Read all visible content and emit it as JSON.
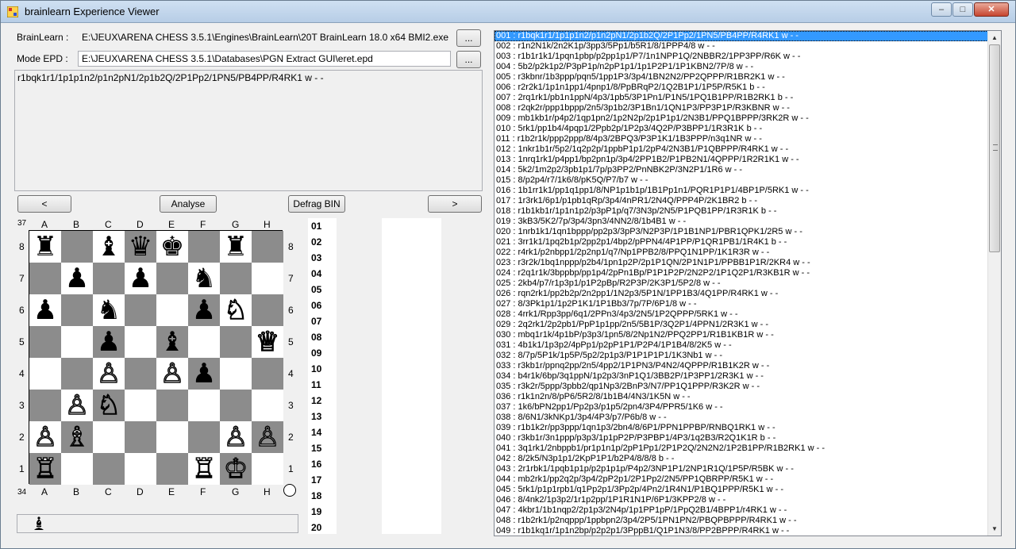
{
  "window": {
    "title": "brainlearn Experience Viewer",
    "minimize": "–",
    "maximize": "□",
    "close": "✕"
  },
  "engine": {
    "label": "BrainLearn :",
    "path": "E:\\JEUX\\ARENA CHESS 3.5.1\\Engines\\BrainLearn\\20T BrainLearn 18.0 x64 BMI2.exe",
    "browse": "..."
  },
  "epd": {
    "label": "Mode EPD :",
    "path": "E:\\JEUX\\ARENA CHESS 3.5.1\\Databases\\PGN Extract GUI\\eret.epd",
    "browse": "..."
  },
  "fen": "r1bqk1r1/1p1p1n2/p1n2pN1/2p1b2Q/2P1Pp2/1PN5/PB4PP/R4RK1 w - -",
  "buttons": {
    "prev": "<",
    "analyse": "Analyse",
    "defrag": "Defrag BIN",
    "next": ">"
  },
  "board": {
    "move_top": "37",
    "move_bottom": "34",
    "files": [
      "A",
      "B",
      "C",
      "D",
      "E",
      "F",
      "G",
      "H"
    ],
    "ranks": [
      "8",
      "7",
      "6",
      "5",
      "4",
      "3",
      "2",
      "1"
    ],
    "pieces": [
      [
        "r",
        "",
        "b",
        "q",
        "k",
        "",
        "r",
        ""
      ],
      [
        "",
        "p",
        "",
        "p",
        "",
        "n",
        "",
        ""
      ],
      [
        "p",
        "",
        "n",
        "",
        "",
        "p",
        "N",
        ""
      ],
      [
        "",
        "",
        "p",
        "",
        "b",
        "",
        "",
        "Q"
      ],
      [
        "",
        "",
        "P",
        "",
        "P",
        "p",
        "",
        ""
      ],
      [
        "",
        "P",
        "N",
        "",
        "",
        "",
        "",
        ""
      ],
      [
        "P",
        "B",
        "",
        "",
        "",
        "",
        "P",
        "P"
      ],
      [
        "R",
        "",
        "",
        "",
        "",
        "R",
        "K",
        ""
      ]
    ]
  },
  "move_numbers": [
    "01",
    "02",
    "03",
    "04",
    "05",
    "06",
    "07",
    "08",
    "09",
    "10",
    "11",
    "12",
    "13",
    "14",
    "15",
    "16",
    "17",
    "18",
    "19",
    "20"
  ],
  "status_icon": "black-bishop-icon",
  "positions": [
    "001 : r1bqk1r1/1p1p1n2/p1n2pN1/2p1b2Q/2P1Pp2/1PN5/PB4PP/R4RK1 w - -",
    "002 : r1n2N1k/2n2K1p/3pp3/5Pp1/b5R1/8/1PPP4/8 w - -",
    "003 : r1b1r1k1/1pqn1pbp/p2pp1p1/P7/1n1NPP1Q/2NBBR2/1PP3PP/R6K w - -",
    "004 : 5b2/p2k1p2/P3pP1p/n2pP1p1/1p1P2P1/1P1KBN2/7P/8 w - -",
    "005 : r3kbnr/1b3ppp/pqn5/1pp1P3/3p4/1BN2N2/PP2QPPP/R1BR2K1 w - -",
    "006 : r2r2k1/1p1n1pp1/4pnp1/8/PpBRqP2/1Q2B1P1/1P5P/R5K1 b - -",
    "007 : 2rq1rk1/pb1n1ppN/4p3/1pb5/3P1Pn1/P1N5/1PQ1B1PP/R1B2RK1 b - -",
    "008 : r2qk2r/ppp1bppp/2n5/3p1b2/3P1Bn1/1QN1P3/PP3P1P/R3KBNR w - -",
    "009 : mb1kb1r/p4p2/1qp1pn2/1p2N2p/2p1P1p1/2N3B1/PPQ1BPPP/3RK2R w - -",
    "010 : 5rk1/pp1b4/4pqp1/2Ppb2p/1P2p3/4Q2P/P3BPP1/1R3R1K b - -",
    "011 : r1b2r1k/ppp2ppp/8/4p3/2BPQ3/P3P1K1/1B3PPP/n3q1NR w - -",
    "012 : 1nkr1b1r/5p2/1q2p2p/1ppbP1p1/2pP4/2N3B1/P1QBPPP/R4RK1 w - -",
    "013 : 1nrq1rk1/p4pp1/bp2pn1p/3p4/2PP1B2/P1PB2N1/4QPPP/1R2R1K1 w - -",
    "014 : 5k2/1m2p2/3pb1p1/7p/p3PP2/PnNBK2P/3N2P1/1R6 w - -",
    "015 : 8/p2p4/r7/1k6/8/pK5Q/P7/b7 w - -",
    "016 : 1b1rr1k1/pp1q1pp1/8/NP1p1b1p/1B1Pp1n1/PQR1P1P1/4BP1P/5RK1 w - -",
    "017 : 1r3rk1/6p1/p1pb1qRp/3p4/4nPR1/2N4Q/PPP4P/2K1BR2 b - -",
    "018 : r1b1kb1r/1p1n1p2/p3pP1p/q7/3N3p/2N5/P1PQB1PP/1R3R1K b - -",
    "019 : 3kB3/5K2/7p/3p4/3pn3/4NN2/8/1b4B1 w - -",
    "020 : 1nrb1k1/1qn1bppp/pp2p3/3pP3/N2P3P/1P1B1NP1/PBR1QPK1/2R5 w - -",
    "021 : 3rr1k1/1pq2b1p/2pp2p1/4bp2/pPPN4/4P1PP/P1QR1PB1/1R4K1 b - -",
    "022 : r4rk1/p2nbpp1/2p2np1/q7/Np1PPB2/8/PPQ1N1PP/1K1R3R w - -",
    "023 : r3r2k/1bq1nppp/p2b4/1pn1p2P/2p1P1QN/2P1N1P1/PPBB1P1R/2KR4 w - -",
    "024 : r2q1r1k/3bppbp/pp1p4/2pPn1Bp/P1P1P2P/2N2P2/1P1Q2P1/R3KB1R w - -",
    "025 : 2kb4/p7/r1p3p1/p1P2pBp/R2P3P/2K3P1/5P2/8 w - -",
    "026 : rqn2rk1/pp2b2p/2n2pp1/1N2p3/5P1N/1PP1B3/4Q1PP/R4RK1 w - -",
    "027 : 8/3Pk1p1/1p2P1K1/1P1Bb3/7p/7P/6P1/8 w - -",
    "028 : 4rrk1/Rpp3pp/6q1/2PPn3/4p3/2N5/1P2QPPP/5RK1 w - -",
    "029 : 2q2rk1/2p2pb1/PpP1p1pp/2n5/5B1P/3Q2P1/4PPN1/2R3K1 w - -",
    "030 : mbq1r1k/4p1bP/p3p3/1pn5/8/2Np1N2/PPQ2PP1/R1B1KB1R w - -",
    "031 : 4b1k1/1p3p2/4pPp1/p2pP1P1/P2P4/1P1B4/8/2K5 w - -",
    "032 : 8/7p/5P1k/1p5P/5p2/2p1p3/P1P1P1P1/1K3Nb1 w - -",
    "033 : r3kb1r/ppnq2pp/2n5/4pp2/1P1PN3/P4N2/4QPPP/R1B1K2R w - -",
    "034 : b4r1k/6bp/3q1ppN/1p2p3/3nP1Q1/3BB2P/1P3PP1/2R3K1 w - -",
    "035 : r3k2r/5ppp/3pbb2/qp1Np3/2BnP3/N7/PP1Q1PPP/R3K2R w - -",
    "036 : r1k1n2n/8/pP6/5R2/8/1b1B4/4N3/1K5N w - -",
    "037 : 1k6/bPN2pp1/Pp2p3/p1p5/2pn4/3P4/PPR5/1K6 w - -",
    "038 : 8/6N1/3kNKp1/3p4/4P3/p7/P6b/8 w - -",
    "039 : r1b1k2r/pp3ppp/1qn1p3/2bn4/8/6P1/PPN1PPBP/RNBQ1RK1 w - -",
    "040 : r3kb1r/3n1ppp/p3p3/1p1pP2P/P3PBP1/4P3/1q2B3/R2Q1K1R b - -",
    "041 : 3q1rk1/2nbppb1/pr1p1n1p/2pP1Pp1/2P1P2Q/2N2N2/1P2B1PP/R1B2RK1 w - -",
    "042 : 8/2k5/N3p1p1/2KpP1P1/b2P4/8/8/8 b - -",
    "043 : 2r1rbk1/1pqb1p1p/p2p1p1p/P4p2/3NP1P1/2NP1R1Q/1P5P/R5BK w - -",
    "044 : mb2rk1/pp2q2p/3p4/2pP2p1/2P1Pp2/2N5/PP1QBRPP/R5K1 w - -",
    "045 : 5rk1/p1p1rpb1/q1Pp2p1/3Pp2p/4Pn2/1R4N1/P1BQ1PPP/R5K1 w - -",
    "046 : 8/4nk2/1p3p2/1r1p2pp/1P1R1N1P/6P1/3KPP2/8 w - -",
    "047 : 4kbr1/1b1nqp2/2p1p3/2N4p/1p1PP1pP/1PpQ2B1/4BPP1/r4RK1 w - -",
    "048 : r1b2rk1/p2nqppp/1ppbpn2/3p4/2P5/1PN1PN2/PBQPBPPP/R4RK1 w - -",
    "049 : r1b1kq1r/1p1n2bp/p2p2p1/3PppB1/Q1P1N3/8/PP2BPPP/R4RK1 w - -"
  ],
  "colors": {
    "light_square": "#ffffff",
    "dark_square": "#8c8c8c",
    "selection": "#3399ff"
  }
}
